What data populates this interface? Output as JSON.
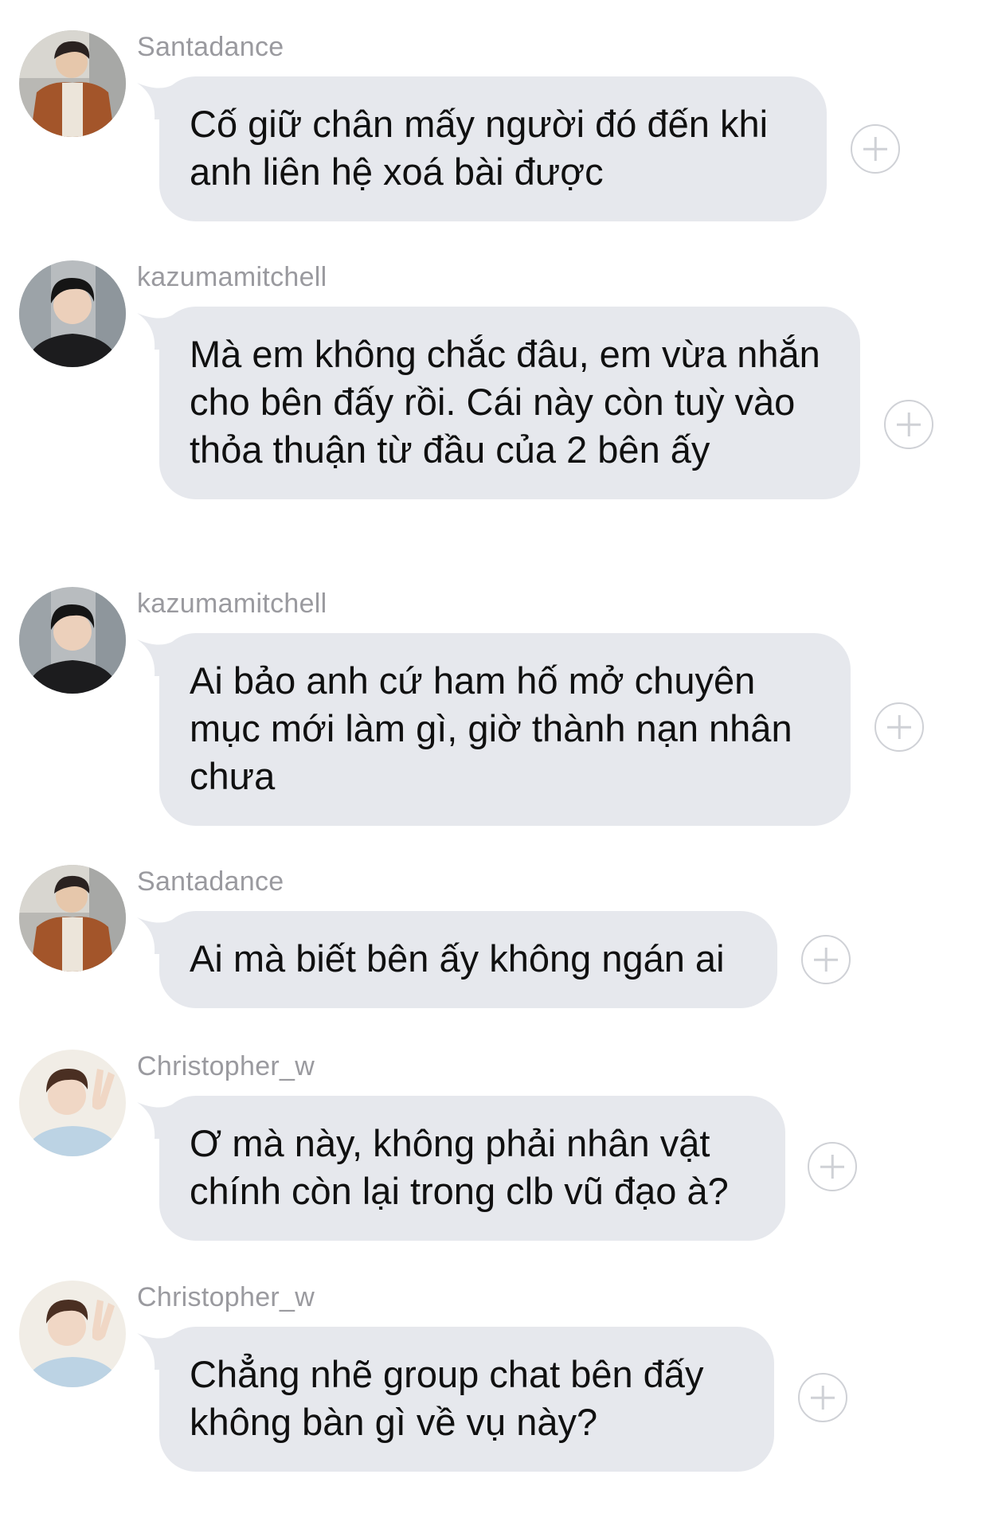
{
  "messages": [
    {
      "username": "Santadance",
      "avatar_icon": "avatar-santadance",
      "text": "Cố giữ chân mấy người đó đến khi anh liên hệ xoá bài được"
    },
    {
      "username": "kazumamitchell",
      "avatar_icon": "avatar-kazumamitchell",
      "text": "Mà em không chắc đâu, em vừa nhắn cho bên đấy rồi. Cái này còn tuỳ vào thỏa thuận từ đầu của 2 bên ấy"
    },
    {
      "username": "kazumamitchell",
      "avatar_icon": "avatar-kazumamitchell",
      "text": "Ai bảo anh cứ ham hố mở chuyên mục mới làm gì, giờ thành nạn nhân chưa"
    },
    {
      "username": "Santadance",
      "avatar_icon": "avatar-santadance",
      "text": "Ai mà biết bên ấy không ngán ai"
    },
    {
      "username": "Christopher_w",
      "avatar_icon": "avatar-christopher",
      "text": "Ơ mà này, không phải nhân vật chính còn lại trong clb vũ đạo à?"
    },
    {
      "username": "Christopher_w",
      "avatar_icon": "avatar-christopher",
      "text": "Chẳng nhẽ group chat bên đấy không bàn gì về vụ này?"
    }
  ],
  "colors": {
    "bubble": "#e6e8ed",
    "username": "#9a9a9f",
    "text": "#101010",
    "plus_icon": "#cfd1d6"
  }
}
